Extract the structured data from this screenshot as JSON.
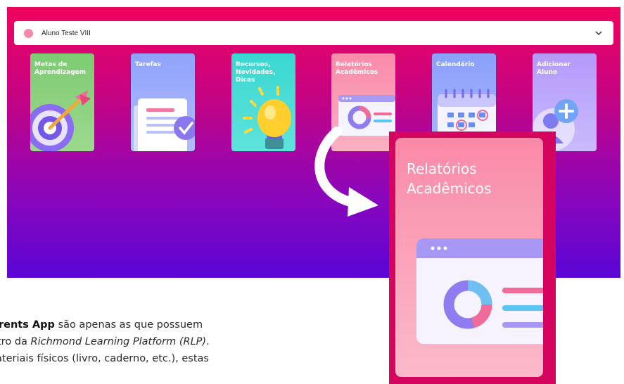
{
  "student_selector": {
    "name": "Aluno Teste VIII",
    "dot_color": "#f48aa9",
    "chevron_icon": "chevron-down-icon"
  },
  "cards": [
    {
      "label": "Metas de\nAprendizagem",
      "icon": "target-arrow-icon",
      "color": "#7dcb72"
    },
    {
      "label": "Tarefas",
      "icon": "checklist-document-icon",
      "color": "#8fa2fb"
    },
    {
      "label": "Recursos,\nNovidades,\nDicas",
      "icon": "lightbulb-icon",
      "color": "#39d7d0"
    },
    {
      "label": "Relatórios\nAcadêmicos",
      "icon": "report-chart-icon",
      "color": "#f98aa8"
    },
    {
      "label": "Calendário",
      "icon": "calendar-icon",
      "color": "#8aa0fb"
    },
    {
      "label": "Adicionar\nAluno",
      "icon": "add-user-icon",
      "color": "#b39afb"
    }
  ],
  "zoom_callout": {
    "label": "Relatórios\nAcadêmicos",
    "icon": "report-chart-icon",
    "frame_color": "#d5045f"
  },
  "caption": {
    "line1_bold": "rents App",
    "line1_rest": " são apenas as que possuem",
    "line2_start": "tro da ",
    "line2_italic": "Richmond Learning Platform (RLP)",
    "line2_end": ".",
    "line3": "ateriais físicos (livro, caderno, etc.), estas"
  },
  "colors": {
    "gradient_top": "#f0035d",
    "gradient_bottom": "#5a05d6"
  }
}
